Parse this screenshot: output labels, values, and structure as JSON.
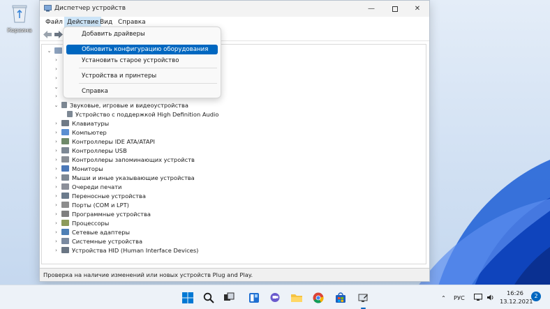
{
  "desktop": {
    "recycle_label": "Корзина"
  },
  "window": {
    "title": "Диспетчер устройств",
    "menu": [
      "Файл",
      "Действие",
      "Вид",
      "Справка"
    ]
  },
  "dropdown": {
    "items": [
      "Добавить драйверы",
      "Обновить конфигурацию оборудования",
      "Установить старое устройство",
      "Устройства и принтеры",
      "Справка"
    ]
  },
  "tree": {
    "audio_group": "Звуковые, игровые и видеоустройства",
    "audio_child": "Устройство с поддержкой High Definition Audio",
    "categories": [
      "Клавиатуры",
      "Компьютер",
      "Контроллеры IDE ATA/ATAPI",
      "Контроллеры USB",
      "Контроллеры запоминающих устройств",
      "Мониторы",
      "Мыши и иные указывающие устройства",
      "Очереди печати",
      "Переносные устройства",
      "Порты (COM и LPT)",
      "Программные устройства",
      "Процессоры",
      "Сетевые адаптеры",
      "Системные устройства",
      "Устройства HID (Human Interface Devices)"
    ]
  },
  "status": "Проверка на наличие изменений или новых устройств Plug and Play.",
  "taskbar": {
    "language": "РУС",
    "time": "16:26",
    "date": "13.12.2021",
    "notifications": "2"
  },
  "colors": {
    "accent": "#0067c0",
    "menu_active": "#cce4f7"
  }
}
